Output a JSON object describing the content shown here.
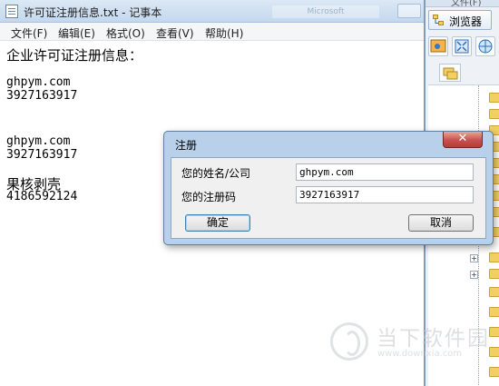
{
  "notepad": {
    "title": "许可证注册信息.txt - 记事本",
    "ghost_tab": "Microsoft",
    "menu": [
      "文件(F)",
      "编辑(E)",
      "格式(O)",
      "查看(V)",
      "帮助(H)"
    ],
    "lines": [
      "企业许可证注册信息：",
      "ghpym.com",
      "3927163917",
      "ghpym.com",
      "3927163917",
      "果核剥壳",
      "4186592124"
    ]
  },
  "side_panel": {
    "top_strip": "文件(F)",
    "tab_label": "浏览器"
  },
  "dialog": {
    "title": "注册",
    "close_glyph": "✕",
    "name_label": "您的姓名/公司",
    "name_value": "ghpym.com",
    "code_label": "您的注册码",
    "code_value": "3927163917",
    "ok_label": "确定",
    "cancel_label": "取消"
  },
  "watermark": {
    "name": "当下软件园",
    "url": "www.downxia.com"
  },
  "colors": {
    "dialog_frame": "#b8d0ea",
    "close_button": "#c75050",
    "folder": "#f2cf5e"
  }
}
